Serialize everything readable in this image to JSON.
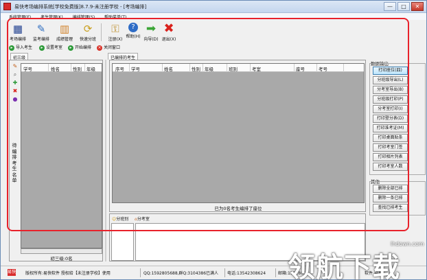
{
  "window": {
    "title": "易快考场编排系统[学校免费版]8.7.9-未注册学校 - [考场编排]",
    "minimize": "—",
    "maximize": "□",
    "close": "✕"
  },
  "menubar": [
    "系统管理(F)",
    "考生管理(K)",
    "编排管理(S)",
    "帮助菜单(T)"
  ],
  "toolbar": [
    {
      "label": "考场编排",
      "icon": "grid-icon"
    },
    {
      "label": "监考编排",
      "icon": "pen-icon"
    },
    {
      "label": "成绩管理",
      "icon": "bar-chart-icon"
    },
    {
      "label": "快速分班",
      "icon": "refresh-icon"
    },
    {
      "label": "注册(X)",
      "icon": "key-icon"
    },
    {
      "label": "帮助(H)",
      "icon": "help-icon"
    },
    {
      "label": "向导(D)",
      "icon": "arrow-right-icon"
    },
    {
      "label": "退出(X)",
      "icon": "exit-icon"
    }
  ],
  "actions": [
    {
      "label": "导入考生",
      "color": "#2e9b3a"
    },
    {
      "label": "设置考室",
      "color": "#2e9b3a"
    },
    {
      "label": "开始编排",
      "color": "#2e9b3a"
    },
    {
      "label": "关闭窗口",
      "color": "#d9342b"
    }
  ],
  "left": {
    "tab": "初三级",
    "vertical_label": "待编排考生名单",
    "columns": [
      "学号",
      "姓名",
      "性别",
      "年级"
    ],
    "footer": "初三级:0名"
  },
  "right": {
    "tab": "已编排的考生",
    "columns": [
      "序号",
      "学号",
      "姓名",
      "性别",
      "年级",
      "班别",
      "考室",
      "座号",
      "考号"
    ],
    "footer": "已为0名考生编排了座位"
  },
  "bottom_tabs": [
    "分班别",
    "分考室"
  ],
  "side": {
    "export_title": "数据输出",
    "export_buttons": [
      "打印座位(四)",
      "分班级导出(L)",
      "分考室导出(B)",
      "分班级打印(P)",
      "分考室打印(I)",
      "打印登分表(D)",
      "打印准考证(M)",
      "打印桌面贴条",
      "打印考室门签",
      "打印相片列表",
      "打印考室人数"
    ],
    "other_title": "其他",
    "other_buttons": [
      "删除全部已排",
      "删除一条已排",
      "查找已排考生"
    ]
  },
  "status": {
    "icon": "易快",
    "copyright": "版权所有:易快软件 授权给【未注册学校】使用",
    "qq": "QQ:1592805688,群Q:3104386已满人",
    "phone": "电话:13542308624",
    "email": "邮箱:15928056",
    "tail": "软件 自有"
  },
  "watermark": {
    "text": "领航下载",
    "site": "lhdown.com"
  }
}
